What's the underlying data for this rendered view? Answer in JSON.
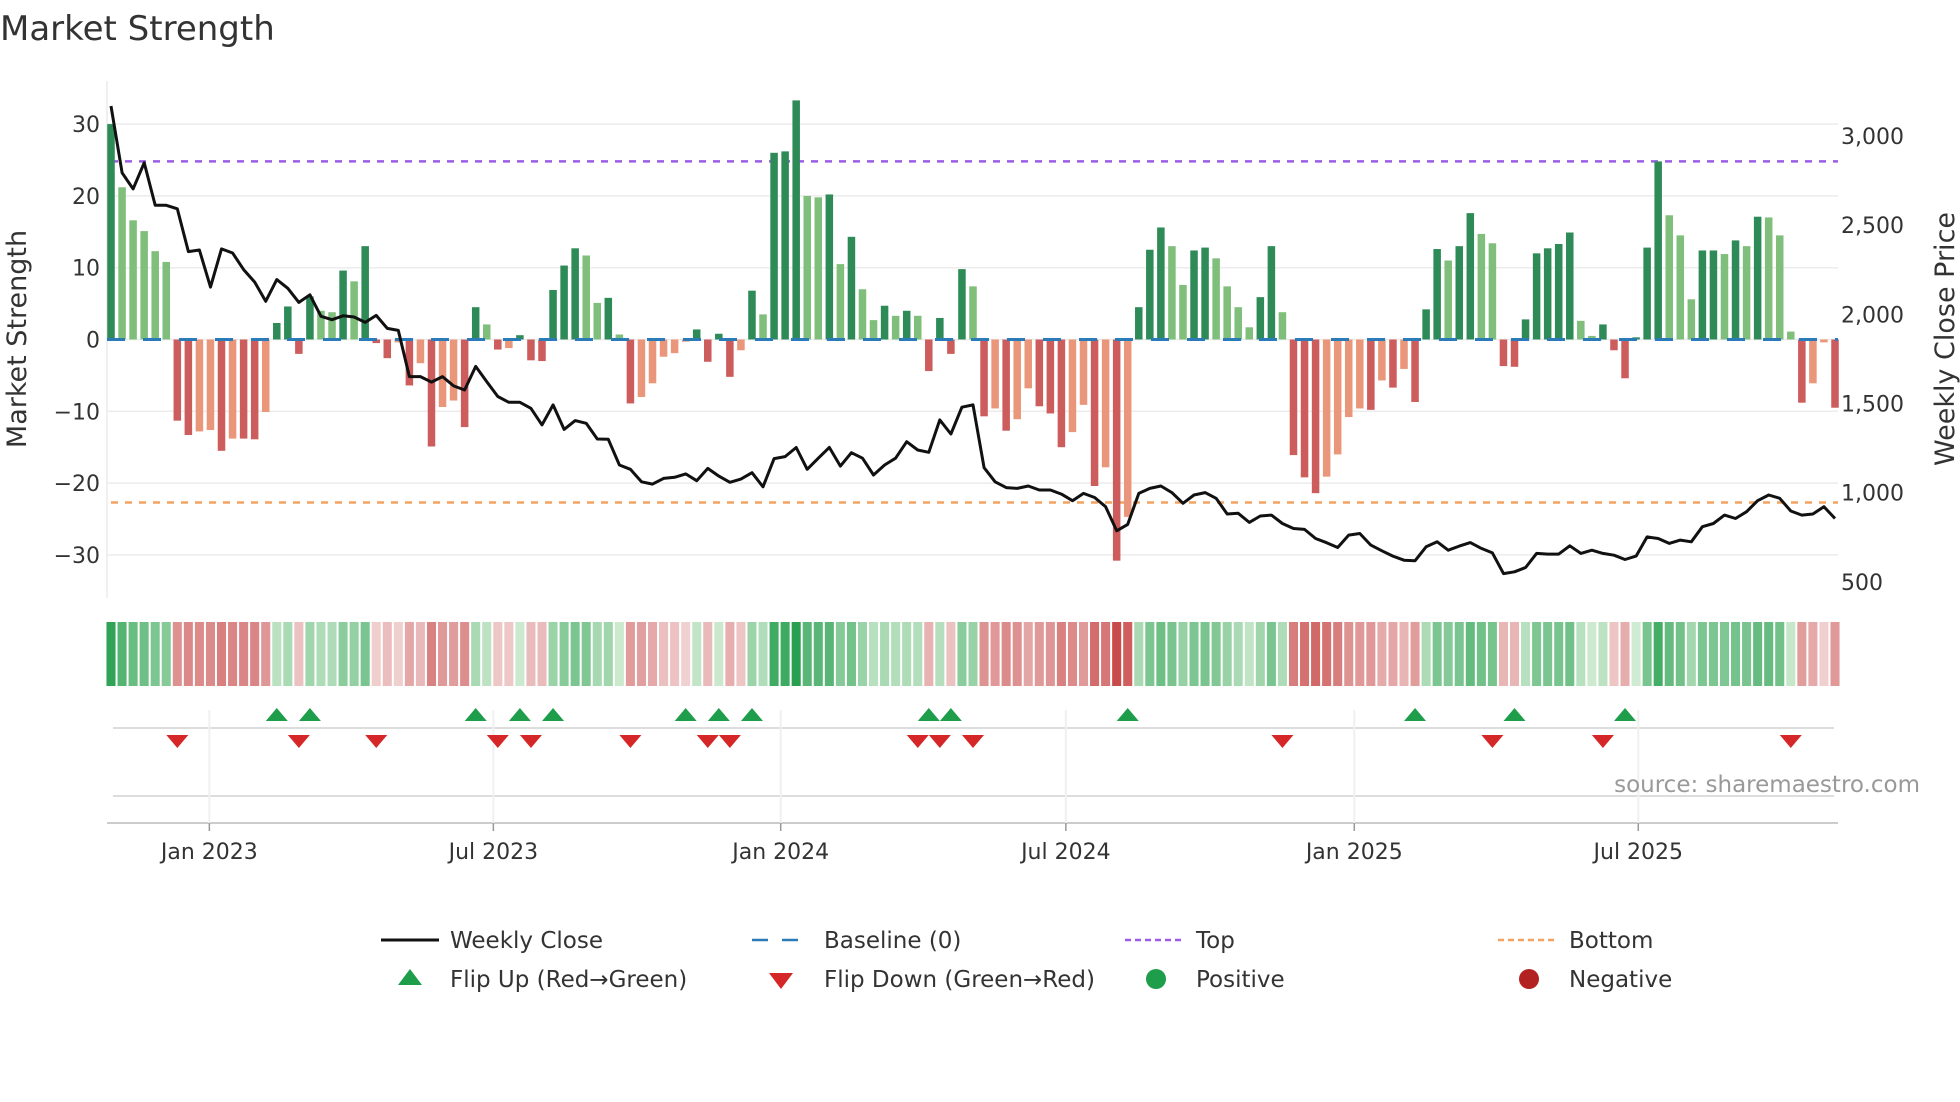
{
  "chart_data": {
    "type": "bar",
    "title": "Market Strength",
    "ylabel": "Market Strength",
    "ylabel_right": "Weekly Close Price",
    "ylim": [
      -36,
      36
    ],
    "ylim_right": [
      409,
      3309
    ],
    "yticks": [
      -30,
      -20,
      -10,
      0,
      10,
      20,
      30
    ],
    "yticks_right": [
      500,
      1000,
      1500,
      2000,
      2500,
      3000
    ],
    "ytick_labels": [
      "−30",
      "−20",
      "−10",
      "0",
      "10",
      "20",
      "30"
    ],
    "ytick_labels_right": [
      "500",
      "1,000",
      "1,500",
      "2,000",
      "2,500",
      "3,000"
    ],
    "x_unit": "week index",
    "xticks": [
      {
        "index": 8.9,
        "label": "Jan 2023"
      },
      {
        "index": 34.6,
        "label": "Jul 2023"
      },
      {
        "index": 60.6,
        "label": "Jan 2024"
      },
      {
        "index": 86.4,
        "label": "Jul 2024"
      },
      {
        "index": 112.5,
        "label": "Jan 2025"
      },
      {
        "index": 138.2,
        "label": "Jul 2025"
      }
    ],
    "grid": true,
    "top_level": 24.8,
    "bottom_level": -22.7,
    "baseline": 0,
    "strength": [
      30,
      21.2,
      16.6,
      15.1,
      12.3,
      10.8,
      -11.3,
      -13.3,
      -12.8,
      -12.6,
      -15.5,
      -13.8,
      -13.8,
      -13.9,
      -10.1,
      2.3,
      4.6,
      -2,
      6,
      4,
      3.8,
      9.6,
      8.1,
      13,
      -0.5,
      -2.6,
      -0.4,
      -6.4,
      -3.3,
      -14.9,
      -9.4,
      -8.5,
      -12.2,
      4.5,
      2.1,
      -1.4,
      -1.2,
      0.6,
      -2.9,
      -3,
      6.9,
      10.3,
      12.7,
      11.7,
      5.1,
      5.8,
      0.7,
      -8.9,
      -8,
      -6.1,
      -2.4,
      -1.9,
      -0.3,
      1.4,
      -3.1,
      0.8,
      -5.2,
      -1.5,
      6.8,
      3.5,
      26,
      26.2,
      33.3,
      20,
      19.8,
      20.2,
      10.5,
      14.3,
      7,
      2.7,
      4.7,
      3.3,
      4,
      3.3,
      -4.4,
      3,
      -2,
      9.8,
      7.4,
      -10.7,
      -9.6,
      -12.7,
      -11.1,
      -6.8,
      -9.3,
      -10.3,
      -15,
      -12.9,
      -9.1,
      -20.4,
      -17.8,
      -30.8,
      -24.7,
      4.5,
      12.5,
      15.6,
      13,
      7.6,
      12.4,
      12.8,
      11.3,
      7.4,
      4.5,
      1.7,
      5.9,
      13,
      3.8,
      -16.1,
      -19.2,
      -21.4,
      -19.1,
      -16,
      -10.8,
      -9.6,
      -9.8,
      -5.7,
      -6.7,
      -4.1,
      -8.7,
      4.2,
      12.6,
      11,
      13,
      17.6,
      14.7,
      13.4,
      -3.7,
      -3.8,
      2.8,
      12,
      12.7,
      13.3,
      14.9,
      2.6,
      0.5,
      2.1,
      -1.5,
      -5.4,
      0.3,
      12.8,
      24.8,
      17.3,
      14.5,
      5.6,
      12.4,
      12.4,
      11.9,
      13.8,
      13,
      17.1,
      17,
      14.5,
      1.1,
      -8.8,
      -6.1,
      -0.4,
      -9.5
    ],
    "weekly_close": [
      3169,
      2794,
      2704,
      2850,
      2612,
      2612,
      2592,
      2352,
      2361,
      2153,
      2367,
      2344,
      2251,
      2181,
      2073,
      2195,
      2146,
      2067,
      2110,
      1989,
      1970,
      1992,
      1985,
      1955,
      1994,
      1921,
      1910,
      1651,
      1651,
      1620,
      1651,
      1599,
      1576,
      1708,
      1623,
      1539,
      1507,
      1507,
      1473,
      1380,
      1492,
      1355,
      1404,
      1389,
      1301,
      1299,
      1155,
      1131,
      1061,
      1048,
      1080,
      1086,
      1105,
      1067,
      1136,
      1093,
      1058,
      1076,
      1112,
      1033,
      1191,
      1202,
      1253,
      1131,
      1193,
      1254,
      1149,
      1224,
      1193,
      1099,
      1155,
      1193,
      1286,
      1239,
      1226,
      1408,
      1329,
      1479,
      1492,
      1140,
      1061,
      1028,
      1024,
      1037,
      1015,
      1015,
      992,
      955,
      996,
      973,
      921,
      786,
      822,
      996,
      1024,
      1037,
      1000,
      940,
      987,
      1000,
      968,
      880,
      884,
      833,
      869,
      874,
      827,
      799,
      794,
      743,
      719,
      692,
      762,
      771,
      706,
      674,
      644,
      621,
      618,
      696,
      724,
      677,
      700,
      720,
      687,
      662,
      546,
      556,
      580,
      659,
      655,
      655,
      702,
      659,
      677,
      659,
      649,
      625,
      644,
      752,
      743,
      715,
      734,
      724,
      809,
      827,
      874,
      855,
      893,
      955,
      987,
      968,
      897,
      874,
      880,
      921,
      855
    ],
    "flip_up_indices": [
      15,
      18,
      33,
      37,
      40,
      52,
      55,
      58,
      74,
      76,
      92,
      118,
      127,
      137
    ],
    "flip_down_indices": [
      6,
      17,
      24,
      35,
      38,
      47,
      54,
      56,
      73,
      75,
      78,
      106,
      125,
      135,
      152
    ],
    "legend": {
      "placement": "bottom",
      "items": [
        {
          "label": "Weekly Close",
          "icon": "line-icon",
          "color": "#111111"
        },
        {
          "label": "Baseline (0)",
          "icon": "dashed-line-icon",
          "color": "#2b7bb9"
        },
        {
          "label": "Top",
          "icon": "dotted-line-icon",
          "color": "#9b5de5"
        },
        {
          "label": "Bottom",
          "icon": "dotted-line-icon",
          "color": "#f4a261"
        },
        {
          "label": "Flip Up (Red→Green)",
          "icon": "triangle-up-icon",
          "color": "#1e9e4a"
        },
        {
          "label": "Flip Down (Green→Red)",
          "icon": "triangle-down-icon",
          "color": "#d62728"
        },
        {
          "label": "Positive",
          "icon": "circle-icon",
          "color": "#1e9e4a"
        },
        {
          "label": "Negative",
          "icon": "circle-icon",
          "color": "#b22222"
        }
      ]
    },
    "colors": {
      "pos_strong": "#2e8b57",
      "pos_weak": "#7fbf7b",
      "neg_strong": "#cd5c5c",
      "neg_weak": "#e9967a"
    },
    "source": "source: sharemaestro.com"
  }
}
